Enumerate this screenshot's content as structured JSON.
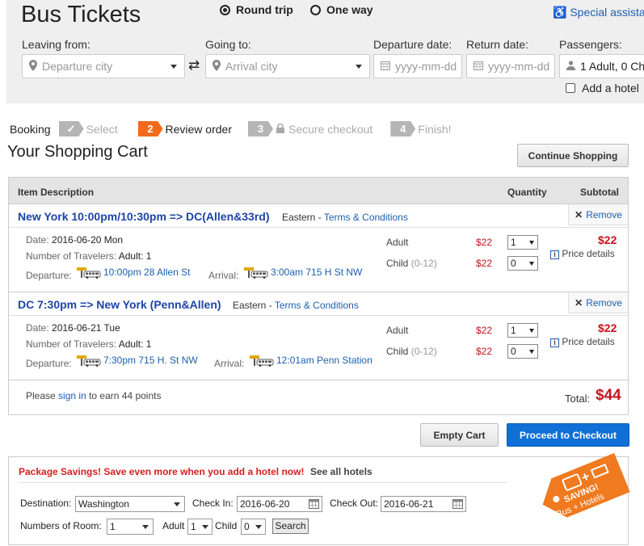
{
  "header": {
    "title": "Bus Tickets",
    "round_trip": "Round trip",
    "one_way": "One way",
    "special": "Special assista"
  },
  "search": {
    "leaving_label": "Leaving from:",
    "leaving_placeholder": "Departure city",
    "going_label": "Going to:",
    "going_placeholder": "Arrival city",
    "departure_label": "Departure date:",
    "departure_placeholder": "yyyy-mm-dd",
    "return_label": "Return date:",
    "return_placeholder": "yyyy-mm-dd",
    "passengers_label": "Passengers:",
    "passengers_value": "1 Adult, 0 Ch",
    "add_hotel": "Add a hotel"
  },
  "steps": {
    "booking": "Booking",
    "s1": "Select",
    "s2_num": "2",
    "s2": "Review order",
    "s3_num": "3",
    "s3": "Secure checkout",
    "s4_num": "4",
    "s4": "Finish!"
  },
  "cart": {
    "title": "Your Shopping Cart",
    "continue": "Continue Shopping",
    "col_item": "Item Description",
    "col_qty": "Quantity",
    "col_sub": "Subtotal",
    "remove": "Remove",
    "date_label": "Date:",
    "travelers_label": "Number of Travelers:",
    "departure_label": "Departure:",
    "arrival_label": "Arrival:",
    "adult": "Adult",
    "child": "Child",
    "child_range": "(0-12)",
    "price_details": "Price details",
    "trips": [
      {
        "route": "New York 10:00pm/10:30pm => DC(Allen&33rd)",
        "carrier": "Eastern -",
        "terms": "Terms & Conditions",
        "date": "2016-06-20 Mon",
        "travelers": "Adult: 1",
        "dep": "10:00pm 28 Allen St",
        "arr": "3:00am 715 H St NW",
        "adult_price": "$22",
        "child_price": "$22",
        "adult_qty": "1",
        "child_qty": "0",
        "subtotal": "$22"
      },
      {
        "route": "DC 7:30pm => New York (Penn&Allen)",
        "carrier": "Eastern -",
        "terms": "Terms & Conditions",
        "date": "2016-06-21 Tue",
        "travelers": "Adult: 1",
        "dep": "7:30pm 715 H. St NW",
        "arr": "12:01am Penn Station",
        "adult_price": "$22",
        "child_price": "$22",
        "adult_qty": "1",
        "child_qty": "0",
        "subtotal": "$22"
      }
    ],
    "please": "Please",
    "sign_in": "sign in",
    "earn": "to earn 44 points",
    "total_label": "Total:",
    "total": "$44",
    "empty": "Empty Cart",
    "checkout": "Proceed to Checkout"
  },
  "package": {
    "headline": "Package Savings! Save even more when you add a hotel now!",
    "see_all": "See all hotels",
    "dest_label": "Destination:",
    "dest_value": "Washington",
    "checkin_label": "Check In:",
    "checkin_value": "2016-06-20",
    "checkout_label": "Check Out:",
    "checkout_value": "2016-06-21",
    "rooms_label": "Numbers of Room:",
    "rooms_value": "1",
    "adult_label": "Adult",
    "adult_value": "1",
    "child_label": "Child",
    "child_value": "0",
    "search": "Search",
    "tag_line1": "SAVING!",
    "tag_line2": "Bus + Hotels"
  },
  "colors": {
    "accent_blue": "#0f6fd6",
    "step_active": "#f26b1d",
    "step_inactive": "#b5b5b5",
    "price_red": "#c4131b",
    "link": "#1d5fb0"
  }
}
